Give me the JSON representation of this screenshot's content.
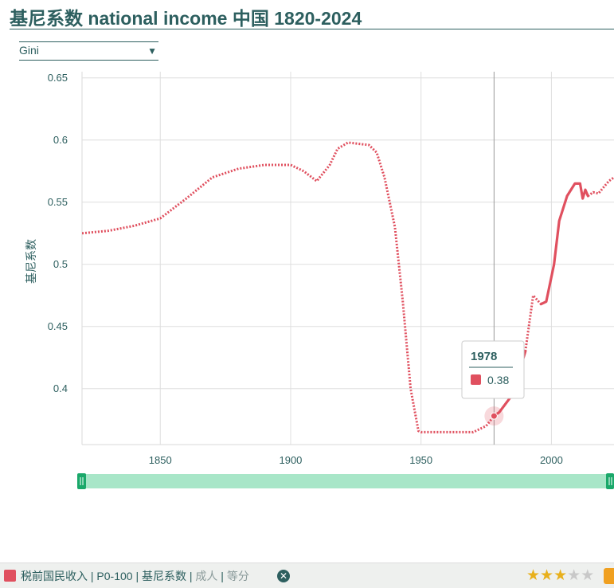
{
  "header": {
    "title": "基尼系数 national income 中国 1820-2024"
  },
  "selector": {
    "value": "Gini"
  },
  "chart_data": {
    "type": "line",
    "ylabel": "基尼系数",
    "xlim": [
      1820,
      2024
    ],
    "ylim": [
      0.355,
      0.655
    ],
    "x_ticks": [
      1850,
      1900,
      1950,
      2000
    ],
    "y_ticks": [
      0.4,
      0.45,
      0.5,
      0.55,
      0.6,
      0.65
    ],
    "y_tick_labels": [
      "0.4",
      "0.45",
      "0.5",
      "0.55",
      "0.6",
      "0.65"
    ],
    "grid": true,
    "series": [
      {
        "name": "税前国民收入 | P0-100 | 基尼系数 | 成人 | 等分",
        "color": "#e0505f",
        "points": [
          [
            1820,
            0.525
          ],
          [
            1830,
            0.527
          ],
          [
            1840,
            0.531
          ],
          [
            1850,
            0.537
          ],
          [
            1860,
            0.553
          ],
          [
            1870,
            0.57
          ],
          [
            1880,
            0.577
          ],
          [
            1890,
            0.58
          ],
          [
            1900,
            0.58
          ],
          [
            1905,
            0.575
          ],
          [
            1910,
            0.567
          ],
          [
            1915,
            0.58
          ],
          [
            1918,
            0.593
          ],
          [
            1922,
            0.598
          ],
          [
            1930,
            0.596
          ],
          [
            1933,
            0.59
          ],
          [
            1936,
            0.57
          ],
          [
            1940,
            0.53
          ],
          [
            1943,
            0.47
          ],
          [
            1946,
            0.4
          ],
          [
            1949,
            0.366
          ],
          [
            1950,
            0.365
          ],
          [
            1960,
            0.365
          ],
          [
            1970,
            0.365
          ],
          [
            1975,
            0.37
          ],
          [
            1978,
            0.378
          ],
          [
            1980,
            0.381
          ],
          [
            1985,
            0.395
          ],
          [
            1990,
            0.43
          ],
          [
            1993,
            0.475
          ],
          [
            1996,
            0.468
          ],
          [
            1998,
            0.47
          ],
          [
            2001,
            0.5
          ],
          [
            2003,
            0.535
          ],
          [
            2006,
            0.555
          ],
          [
            2009,
            0.565
          ],
          [
            2011,
            0.565
          ],
          [
            2012,
            0.553
          ],
          [
            2013,
            0.56
          ],
          [
            2014,
            0.555
          ],
          [
            2016,
            0.558
          ],
          [
            2018,
            0.557
          ],
          [
            2020,
            0.562
          ],
          [
            2022,
            0.567
          ],
          [
            2024,
            0.57
          ]
        ],
        "dotted_ranges": [
          [
            1820,
            1978
          ],
          [
            1990,
            1996
          ],
          [
            2014,
            2024
          ]
        ]
      }
    ],
    "tooltip": {
      "year": "1978",
      "value": "0.38",
      "x": 1978,
      "y": 0.378
    }
  },
  "footer": {
    "legend_main": "税前国民收入 | P0-100 | 基尼系数 | ",
    "legend_muted_1": "成人",
    "legend_sep": " | ",
    "legend_muted_2": "等分",
    "rating": 3,
    "rating_max": 5
  }
}
